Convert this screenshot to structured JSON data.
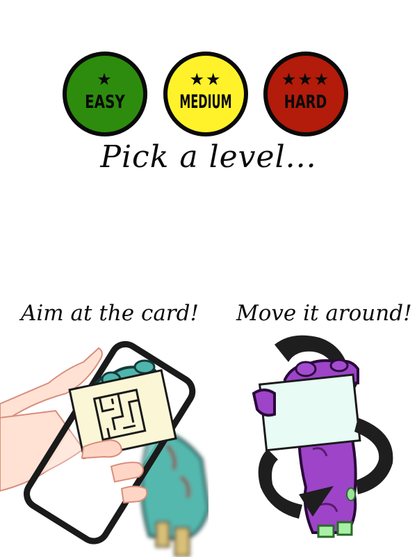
{
  "levels": [
    {
      "id": "easy",
      "label": "EASY",
      "stars": "★",
      "color": "#2d8c0d"
    },
    {
      "id": "medium",
      "label": "MEDIUM",
      "stars": "★★",
      "color": "#fff22a"
    },
    {
      "id": "hard",
      "label": "HARD",
      "stars": "★★★",
      "color": "#b31b0a"
    }
  ],
  "prompt": "Pick a level...",
  "instructions": {
    "aim": "Aim at the card!",
    "move": "Move it around!"
  },
  "colors": {
    "outline": "#0a0a0a",
    "zombie_left": "#4bb0a8",
    "zombie_right": "#9c40c4",
    "card": "#fbf8d8",
    "card_right": "#e6fbf4",
    "skin": "#ffd9c9"
  },
  "icons": {
    "easy_star": "star-icon",
    "phone": "phone-icon",
    "arrows": "rotate-arrow-icon"
  }
}
